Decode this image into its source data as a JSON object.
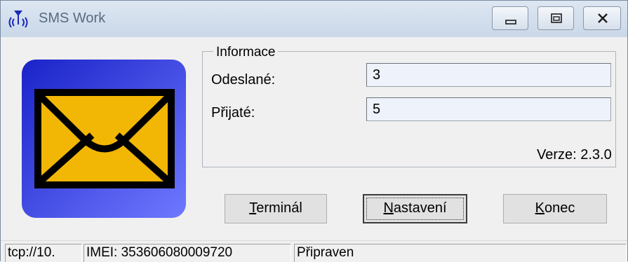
{
  "window": {
    "title": "SMS Work"
  },
  "titlebar_buttons": {
    "minimize": "minimize-icon",
    "restore": "restore-icon",
    "close": "close-icon"
  },
  "icons": {
    "app": "antenna-icon",
    "logo": "envelope-icon"
  },
  "colors": {
    "tile_gradient": [
      "#1a23c8",
      "#6f78ff"
    ],
    "envelope": "#f2b705"
  },
  "info": {
    "legend": "Informace",
    "sent_label": "Odeslané:",
    "sent_value": "3",
    "received_label": "Přijaté:",
    "received_value": "5",
    "version": "Verze: 2.3.0"
  },
  "buttons": {
    "terminal_key": "T",
    "terminal_rest": "erminál",
    "settings_key": "N",
    "settings_rest": "astavení",
    "exit_key": "K",
    "exit_rest": "onec"
  },
  "status": {
    "connection": "tcp://10.",
    "imei": "IMEI: 353606080009720",
    "state": "Připraven"
  }
}
